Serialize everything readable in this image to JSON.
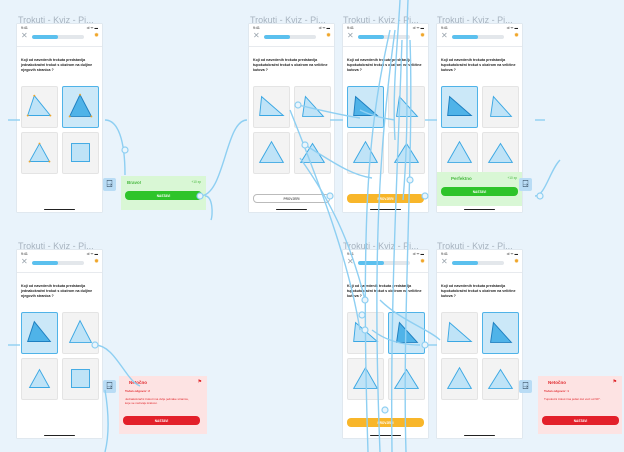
{
  "frames": [
    {
      "title": "Trokuti  - Kviz - Pi..."
    },
    {
      "title": "Trokuti  - Kviz - Pi..."
    },
    {
      "title": "Trokuti  - Kviz - Pi..."
    },
    {
      "title": "Trokuti  - Kviz - Pi..."
    },
    {
      "title": "Trokuti  - Kviz - Pi..."
    },
    {
      "title": "Trokuti  - Kviz - Pi..."
    },
    {
      "title": "Trokuti  - Kviz - Pi..."
    },
    {
      "title": "Trokuti  - Kviz - Pi..."
    }
  ],
  "status": {
    "time": "9:41",
    "signal": "ııl ᯤ ▬"
  },
  "progress": {
    "value": 0.5
  },
  "question_a": "Koji od navedenih trokuta predstavlja jednakokračni trokut s obzirom na duljine njegovih stranica ?",
  "question_b": "Koji od navedenih trokuta predstavlja tupokutokračni trokut s obzirom na veličine kutova ?",
  "buttons": {
    "check": "PROVJERI",
    "continue": "NASTAVI"
  },
  "feedback_correct": [
    {
      "title": "Bravo!",
      "points": "+10 xp",
      "button": "NASTAVI"
    },
    {
      "title": "Perfektno",
      "points": "+10 xp",
      "button": "NASTAVI"
    }
  ],
  "feedback_wrong": [
    {
      "title": "Netočno",
      "line1": "Točan odgovor: 2",
      "line2": "Jednakokračni trokut ima dvije jednake stranice, koje se nazivaju krakovi.",
      "button": "NASTAVI"
    },
    {
      "title": "Netočno",
      "line1": "Točan odgovor: 1",
      "line2": "Tupokutni trokut ima jedan kut veći od 90°.",
      "button": "NASTAVI"
    }
  ],
  "icons": {
    "close": "close-icon",
    "star": "star-icon",
    "flag": "flag-icon",
    "hotspot": "exit-icon"
  },
  "colors": {
    "accent": "#5bc0ee",
    "correct": "#2ec42a",
    "wrong": "#e3202a",
    "check": "#f8b62a",
    "tile_selected": "#cbe8f8",
    "canvas": "#e9f3fb"
  }
}
